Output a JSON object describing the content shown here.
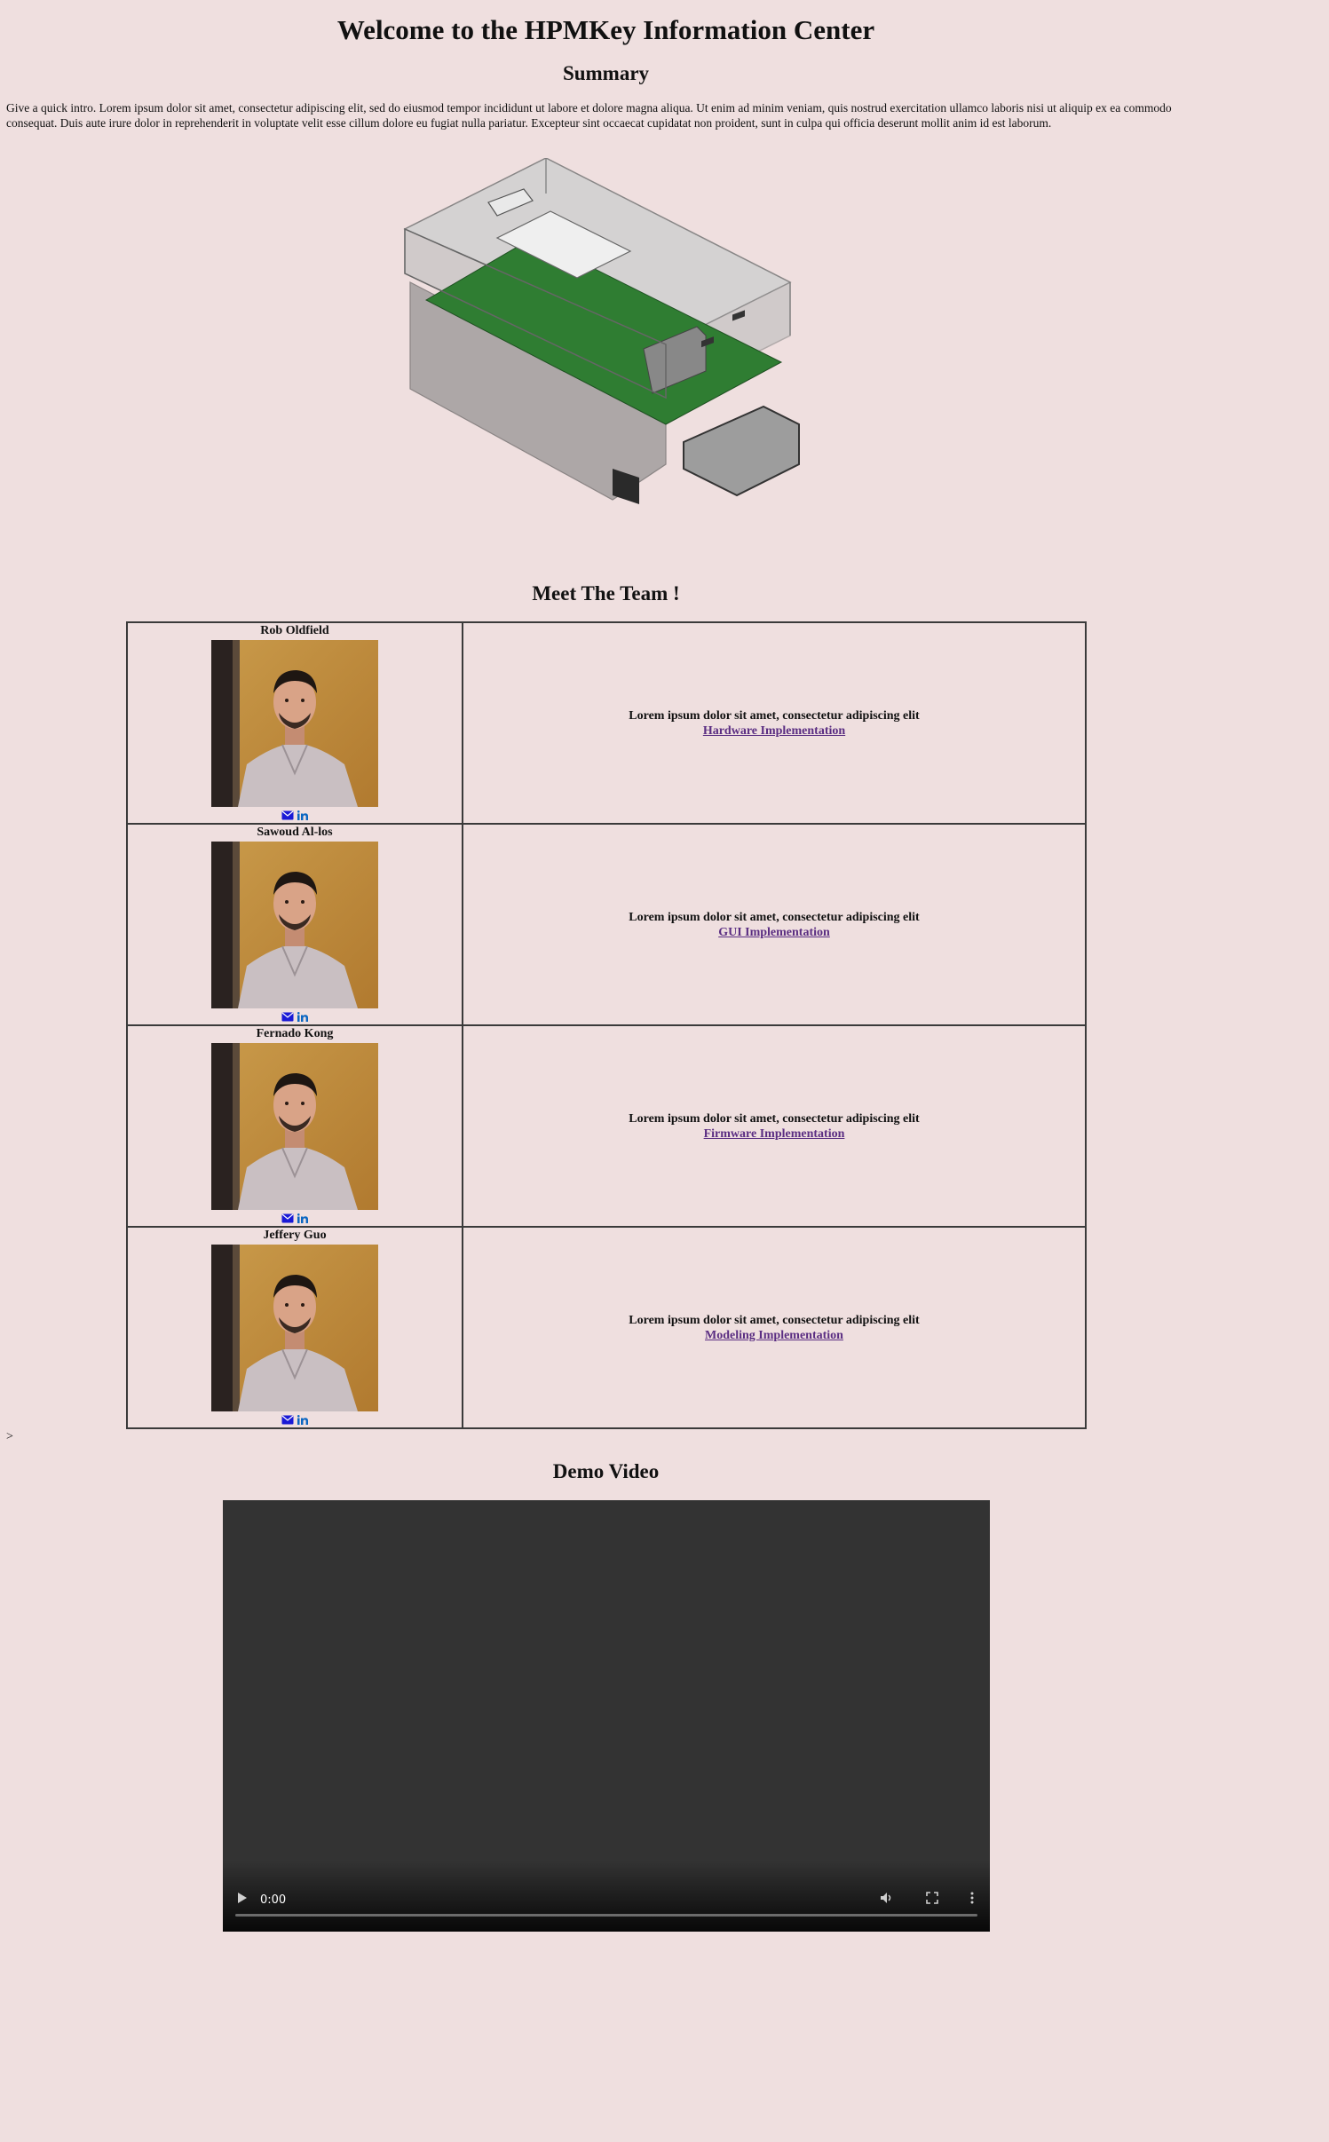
{
  "page": {
    "title": "Welcome to the HPMKey Information Center",
    "summary_heading": "Summary",
    "intro": "Give a quick intro. Lorem ipsum dolor sit amet, consectetur adipiscing elit, sed do eiusmod tempor incididunt ut labore et dolore magna aliqua. Ut enim ad minim veniam, quis nostrud exercitation ullamco laboris nisi ut aliquip ex ea commodo consequat. Duis aute irure dolor in reprehenderit in voluptate velit esse cillum dolore eu fugiat nulla pariatur. Excepteur sint occaecat cupidatat non proident, sunt in culpa qui officia deserunt mollit anim id est laborum.",
    "team_heading": "Meet The Team !",
    "stray_char": ">",
    "video_heading": "Demo Video"
  },
  "team": [
    {
      "name": "Rob Oldfield",
      "desc": "Lorem ipsum dolor sit amet, consectetur adipiscing elit",
      "link": "Hardware Implementation"
    },
    {
      "name": "Sawoud Al-los",
      "desc": "Lorem ipsum dolor sit amet, consectetur adipiscing elit",
      "link": "GUI Implementation"
    },
    {
      "name": "Fernado Kong",
      "desc": "Lorem ipsum dolor sit amet, consectetur adipiscing elit",
      "link": "Firmware Implementation"
    },
    {
      "name": "Jeffery Guo",
      "desc": "Lorem ipsum dolor sit amet, consectetur adipiscing elit",
      "link": "Modeling Implementation"
    }
  ],
  "icons": {
    "email": "envelope-icon",
    "linkedin": "linkedin-icon"
  },
  "video": {
    "time": "0:00",
    "icons": [
      "play-icon",
      "volume-icon",
      "fullscreen-icon",
      "more-options-icon"
    ]
  },
  "colors": {
    "background": "#efdfdf",
    "link_visited": "#5a2d82",
    "email_icon": "#1a1ad6",
    "linkedin_icon": "#0a66c2",
    "video_bg": "#333333"
  }
}
